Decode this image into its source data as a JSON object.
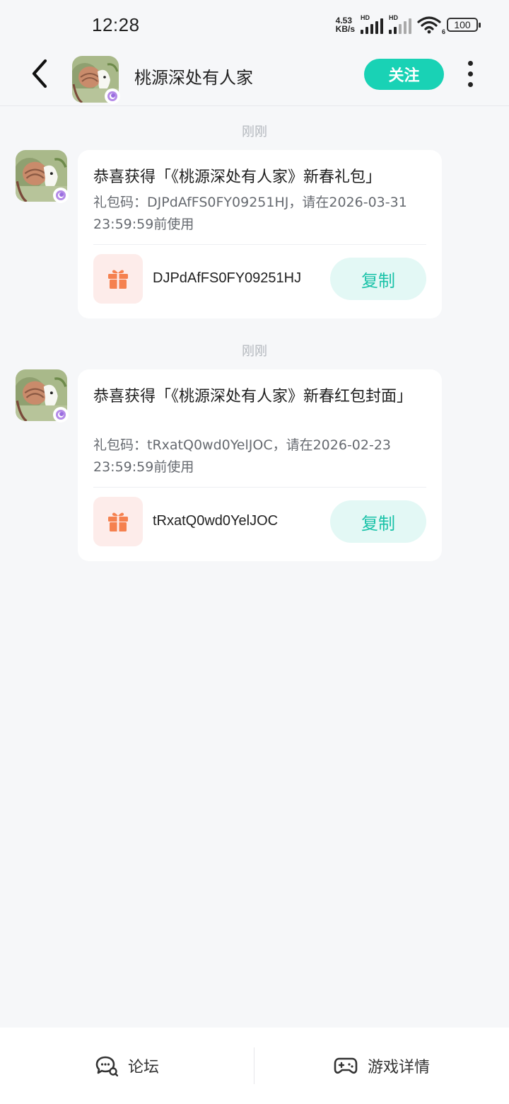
{
  "status_bar": {
    "time": "12:28",
    "net_speed_value": "4.53",
    "net_speed_unit": "KB/s",
    "hd1": "HD",
    "hd2": "HD",
    "wifi_label": "6",
    "battery": "100"
  },
  "header": {
    "title": "桃源深处有人家",
    "follow_label": "关注",
    "avatar_icon": "game-avatar-icon",
    "back_icon": "back-arrow-icon",
    "more_icon": "more-vertical-icon"
  },
  "messages": [
    {
      "time": "刚刚",
      "title": "恭喜获得「《桃源深处有人家》新春礼包」",
      "desc": "礼包码：DJPdAfFS0FY09251HJ，请在2026-03-31 23:59:59前使用",
      "code": "DJPdAfFS0FY09251HJ",
      "copy_label": "复制"
    },
    {
      "time": "刚刚",
      "title": "恭喜获得「《桃源深处有人家》新春红包封面」",
      "desc": "礼包码：tRxatQ0wd0YelJOC，请在2026-02-23 23:59:59前使用",
      "code": "tRxatQ0wd0YelJOC",
      "copy_label": "复制"
    }
  ],
  "bottom_tabs": [
    {
      "label": "论坛",
      "icon": "forum-chat-icon"
    },
    {
      "label": "游戏详情",
      "icon": "gamepad-icon"
    }
  ],
  "colors": {
    "accent": "#19d2b5",
    "copy_bg": "#e3f8f5",
    "gift_bg": "#fdecea",
    "gift_icon": "#f5814f"
  }
}
